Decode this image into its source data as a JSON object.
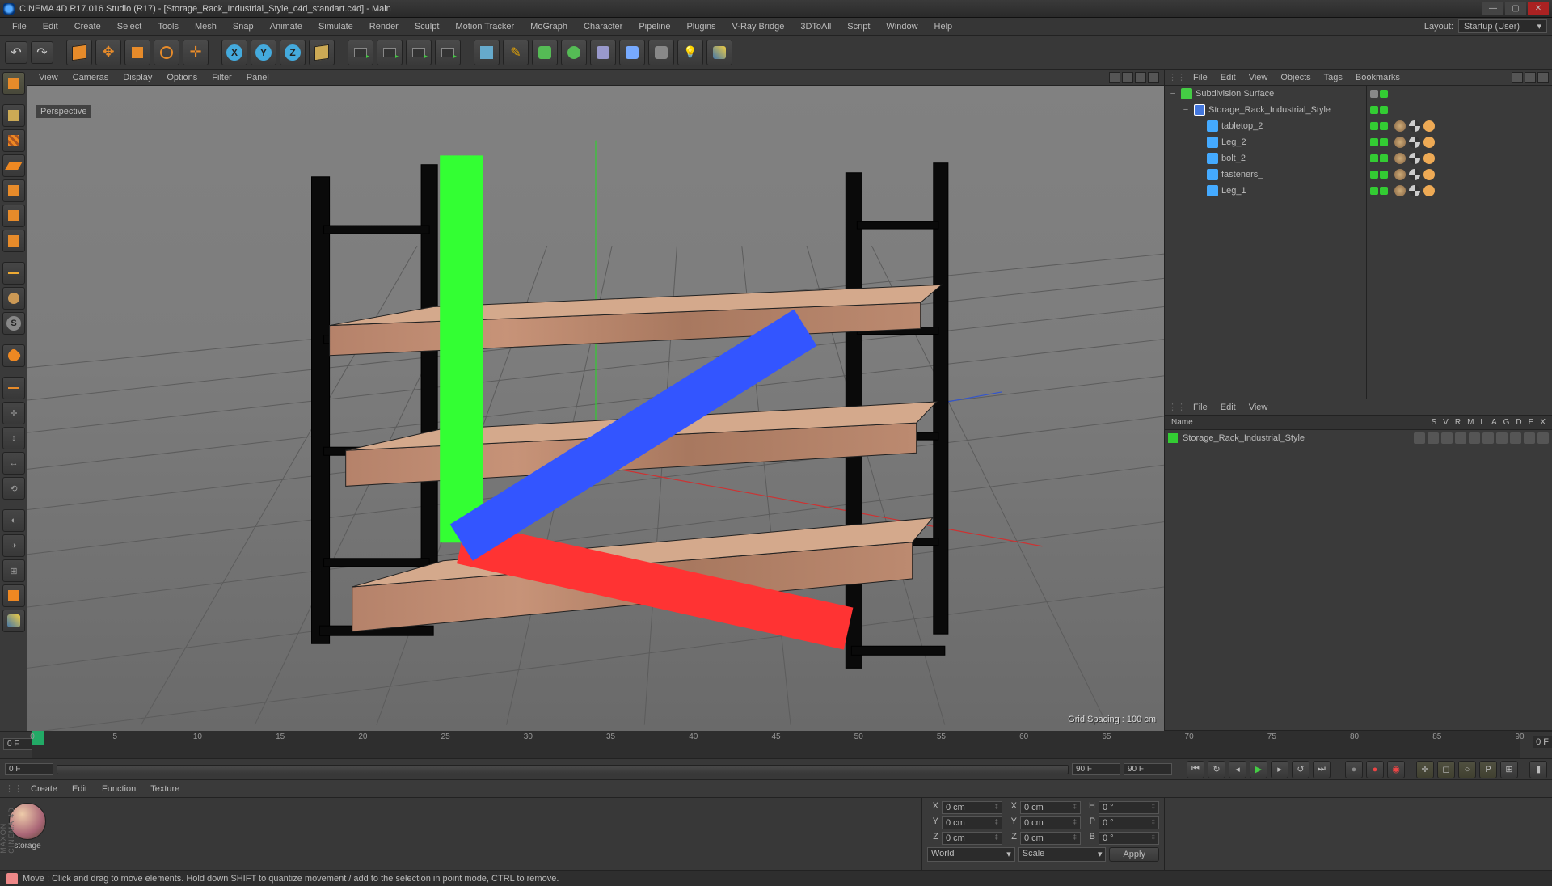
{
  "title": "CINEMA 4D R17.016 Studio (R17) - [Storage_Rack_Industrial_Style_c4d_standart.c4d] - Main",
  "menus": [
    "File",
    "Edit",
    "Create",
    "Select",
    "Tools",
    "Mesh",
    "Snap",
    "Animate",
    "Simulate",
    "Render",
    "Sculpt",
    "Motion Tracker",
    "MoGraph",
    "Character",
    "Pipeline",
    "Plugins",
    "V-Ray Bridge",
    "3DToAll",
    "Script",
    "Window",
    "Help"
  ],
  "layout_label": "Layout:",
  "layout_value": "Startup (User)",
  "axes": [
    "X",
    "Y",
    "Z"
  ],
  "viewport": {
    "menus": [
      "View",
      "Cameras",
      "Display",
      "Options",
      "Filter",
      "Panel"
    ],
    "label": "Perspective",
    "grid_info": "Grid Spacing : 100 cm"
  },
  "obj_panel": {
    "menus": [
      "File",
      "Edit",
      "View",
      "Objects",
      "Tags",
      "Bookmarks"
    ],
    "tree": [
      {
        "lvl": 0,
        "exp": "−",
        "ico": "sds",
        "name": "Subdivision Surface",
        "dots": [
          "gr",
          "g"
        ],
        "tags": []
      },
      {
        "lvl": 1,
        "exp": "−",
        "ico": "null",
        "name": "Storage_Rack_Industrial_Style",
        "dots": [
          "g",
          "g"
        ],
        "tags": []
      },
      {
        "lvl": 2,
        "exp": "",
        "ico": "poly",
        "name": "tabletop_2",
        "dots": [
          "g",
          "g"
        ],
        "tags": [
          "tex",
          "uvw",
          "phg"
        ]
      },
      {
        "lvl": 2,
        "exp": "",
        "ico": "poly",
        "name": "Leg_2",
        "dots": [
          "g",
          "g"
        ],
        "tags": [
          "tex",
          "uvw",
          "phg"
        ]
      },
      {
        "lvl": 2,
        "exp": "",
        "ico": "poly",
        "name": "bolt_2",
        "dots": [
          "g",
          "g"
        ],
        "tags": [
          "tex",
          "uvw",
          "phg"
        ]
      },
      {
        "lvl": 2,
        "exp": "",
        "ico": "poly",
        "name": "fasteners_",
        "dots": [
          "g",
          "g"
        ],
        "tags": [
          "tex",
          "uvw",
          "phg"
        ]
      },
      {
        "lvl": 2,
        "exp": "",
        "ico": "poly",
        "name": "Leg_1",
        "dots": [
          "g",
          "g"
        ],
        "tags": [
          "tex",
          "uvw",
          "phg"
        ]
      }
    ]
  },
  "layer_panel": {
    "menus": [
      "File",
      "Edit",
      "View"
    ],
    "hdrs": [
      "Name",
      "S",
      "V",
      "R",
      "M",
      "L",
      "A",
      "G",
      "D",
      "E",
      "X"
    ],
    "row": "Storage_Rack_Industrial_Style"
  },
  "timeline": {
    "ticks": [
      0,
      5,
      10,
      15,
      20,
      25,
      30,
      35,
      40,
      45,
      50,
      55,
      60,
      65,
      70,
      75,
      80,
      85,
      90
    ],
    "start": "0 F",
    "end": "90 F",
    "cur": "0 F",
    "endframe": "0 F"
  },
  "mat_menus": [
    "Create",
    "Edit",
    "Function",
    "Texture"
  ],
  "material": "storage",
  "coords": {
    "pos": {
      "X": "0 cm",
      "Y": "0 cm",
      "Z": "0 cm"
    },
    "size": {
      "X": "0 cm",
      "Y": "0 cm",
      "Z": "0 cm"
    },
    "hbp": {
      "H": "0 °",
      "P": "0 °",
      "B": "0 °"
    },
    "sys": "World",
    "mode": "Scale",
    "apply": "Apply"
  },
  "status": "Move : Click and drag to move elements. Hold down SHIFT to quantize movement / add to the selection in point mode, CTRL to remove."
}
